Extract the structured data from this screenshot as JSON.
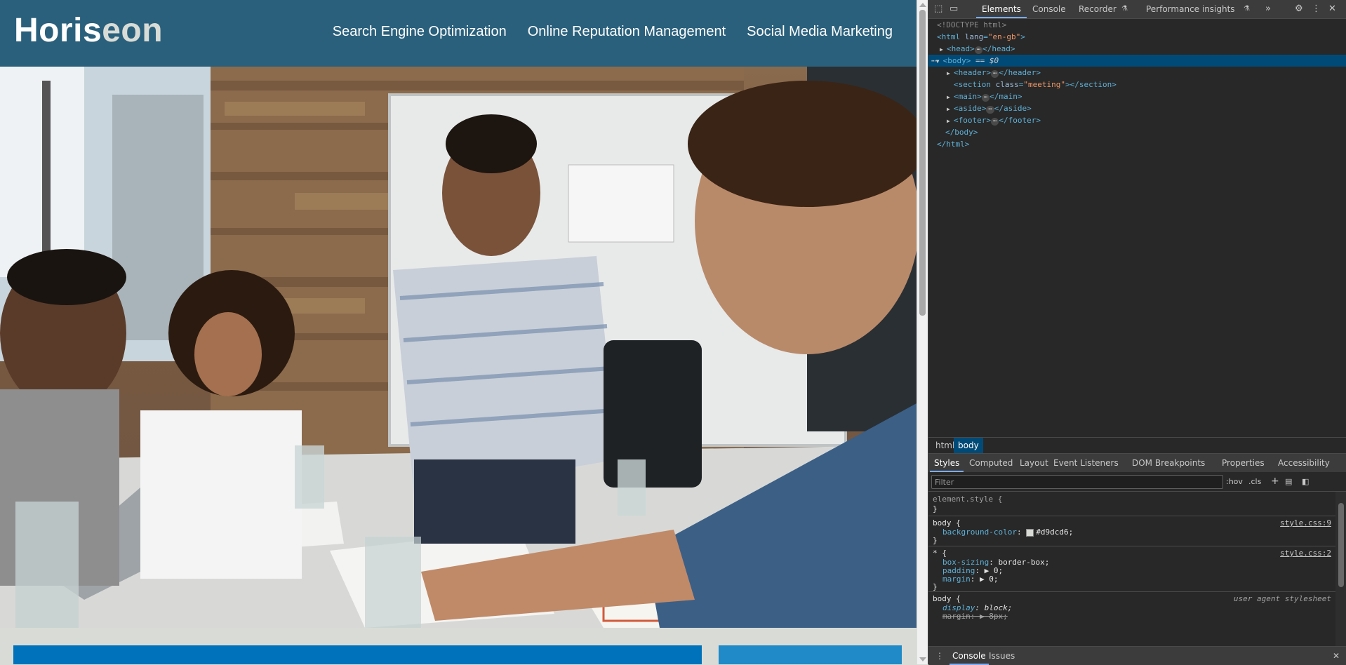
{
  "site": {
    "logo_main": "Horis",
    "logo_accent": "eon",
    "nav": [
      {
        "label": "Search Engine Optimization"
      },
      {
        "label": "Online Reputation Management"
      },
      {
        "label": "Social Media Marketing"
      }
    ],
    "hero_description": "Team meeting photo",
    "colors": {
      "header": "#2a607c",
      "body": "#d9dcd6",
      "band_a": "#0072bb",
      "band_b": "#1f8ac7"
    }
  },
  "devtools": {
    "tabs": [
      "Elements",
      "Console",
      "Recorder",
      "Performance insights"
    ],
    "more_tabs_icon": "chevron-double-right-icon",
    "dom": {
      "doctype": "<!DOCTYPE html>",
      "html_open": "<html",
      "html_attr_name": "lang",
      "html_attr_value": "\"en-gb\"",
      "head": "head",
      "body": "body",
      "body_marker": "== $0",
      "header": "header",
      "section": "section",
      "section_attr_name": "class",
      "section_attr_value": "\"meeting\"",
      "main": "main",
      "aside": "aside",
      "footer": "footer",
      "body_close": "</body>",
      "html_close": "</html>"
    },
    "breadcrumbs": [
      "html",
      "body"
    ],
    "sub_tabs": [
      "Styles",
      "Computed",
      "Layout",
      "Event Listeners",
      "DOM Breakpoints",
      "Properties",
      "Accessibility"
    ],
    "filter": {
      "placeholder": "Filter",
      "hov": ":hov",
      "cls": ".cls"
    },
    "styles": {
      "element_style": "element.style {",
      "close_brace": "}",
      "rule1_selector": "body {",
      "rule1_source": "style.css:9",
      "rule1_prop": "background-color",
      "rule1_value": "#d9dcd6;",
      "rule2_selector": "* {",
      "rule2_source": "style.css:2",
      "rule2_props": [
        {
          "name": "box-sizing",
          "value": "border-box;"
        },
        {
          "name": "padding",
          "value": "▶ 0;"
        },
        {
          "name": "margin",
          "value": "▶ 0;"
        }
      ],
      "rule3_selector": "body {",
      "rule3_source": "user agent stylesheet",
      "rule3_prop1": "display",
      "rule3_val1": "block;",
      "rule3_prop2": "margin",
      "rule3_val2": "▶ 8px;"
    },
    "drawer_tabs": [
      "Console",
      "Issues"
    ]
  }
}
